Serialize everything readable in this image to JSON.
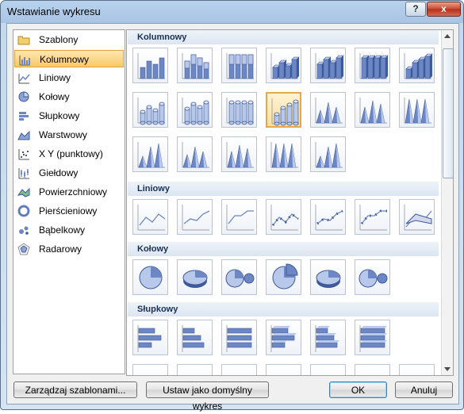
{
  "window": {
    "title": "Wstawianie wykresu",
    "help": "?",
    "close": "x"
  },
  "categories": [
    {
      "label": "Szablony",
      "icon": "folder-icon",
      "selected": false
    },
    {
      "label": "Kolumnowy",
      "icon": "column-chart-icon",
      "selected": true
    },
    {
      "label": "Liniowy",
      "icon": "line-chart-icon",
      "selected": false
    },
    {
      "label": "Kołowy",
      "icon": "pie-chart-icon",
      "selected": false
    },
    {
      "label": "Słupkowy",
      "icon": "bar-chart-icon",
      "selected": false
    },
    {
      "label": "Warstwowy",
      "icon": "area-chart-icon",
      "selected": false
    },
    {
      "label": "X Y (punktowy)",
      "icon": "scatter-chart-icon",
      "selected": false
    },
    {
      "label": "Giełdowy",
      "icon": "stock-chart-icon",
      "selected": false
    },
    {
      "label": "Powierzchniowy",
      "icon": "surface-chart-icon",
      "selected": false
    },
    {
      "label": "Pierścieniowy",
      "icon": "doughnut-chart-icon",
      "selected": false
    },
    {
      "label": "Bąbelkowy",
      "icon": "bubble-chart-icon",
      "selected": false
    },
    {
      "label": "Radarowy",
      "icon": "radar-chart-icon",
      "selected": false
    }
  ],
  "sections": [
    {
      "title": "Kolumnowy",
      "kind": "column",
      "count": 19,
      "selected_index": 10
    },
    {
      "title": "Liniowy",
      "kind": "line",
      "count": 7
    },
    {
      "title": "Kołowy",
      "kind": "pie",
      "count": 6
    },
    {
      "title": "Słupkowy",
      "kind": "bar",
      "count": 6
    }
  ],
  "buttons": {
    "manage_templates": "Zarządzaj szablonami...",
    "set_default": "Ustaw jako domyślny wykres",
    "ok": "OK",
    "cancel": "Anuluj"
  },
  "colors": {
    "accent": "#6d87c5",
    "selection": "#f9c96b",
    "section_text": "#1b3153"
  }
}
